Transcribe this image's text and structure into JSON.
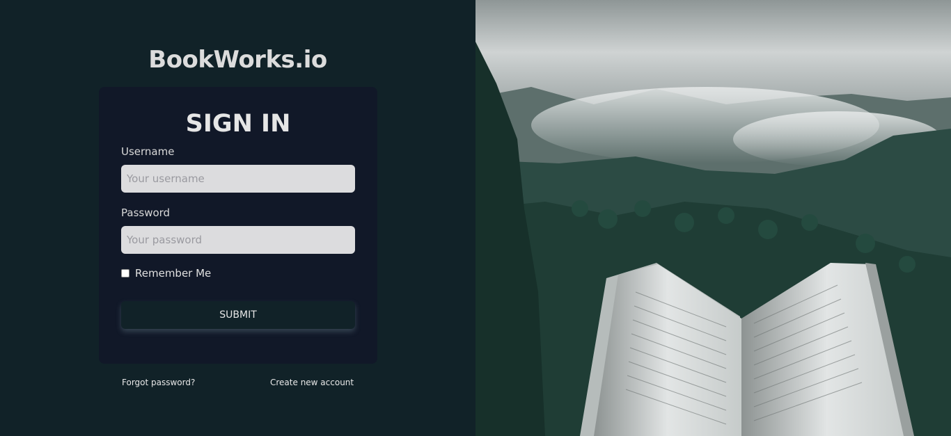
{
  "brand": {
    "name": "BookWorks.io"
  },
  "signin": {
    "title": "SIGN IN",
    "username_label": "Username",
    "username_placeholder": "Your username",
    "password_label": "Password",
    "password_placeholder": "Your password",
    "remember_label": "Remember Me",
    "remember_checked": false,
    "submit_label": "SUBMIT"
  },
  "links": {
    "forgot_password": "Forgot password?",
    "create_account": "Create new account"
  },
  "colors": {
    "left_background": "#112228",
    "card_background": "#111828",
    "input_background": "#dcdcde"
  },
  "hero_image": {
    "icon": "open-book-over-misty-forest-image"
  }
}
